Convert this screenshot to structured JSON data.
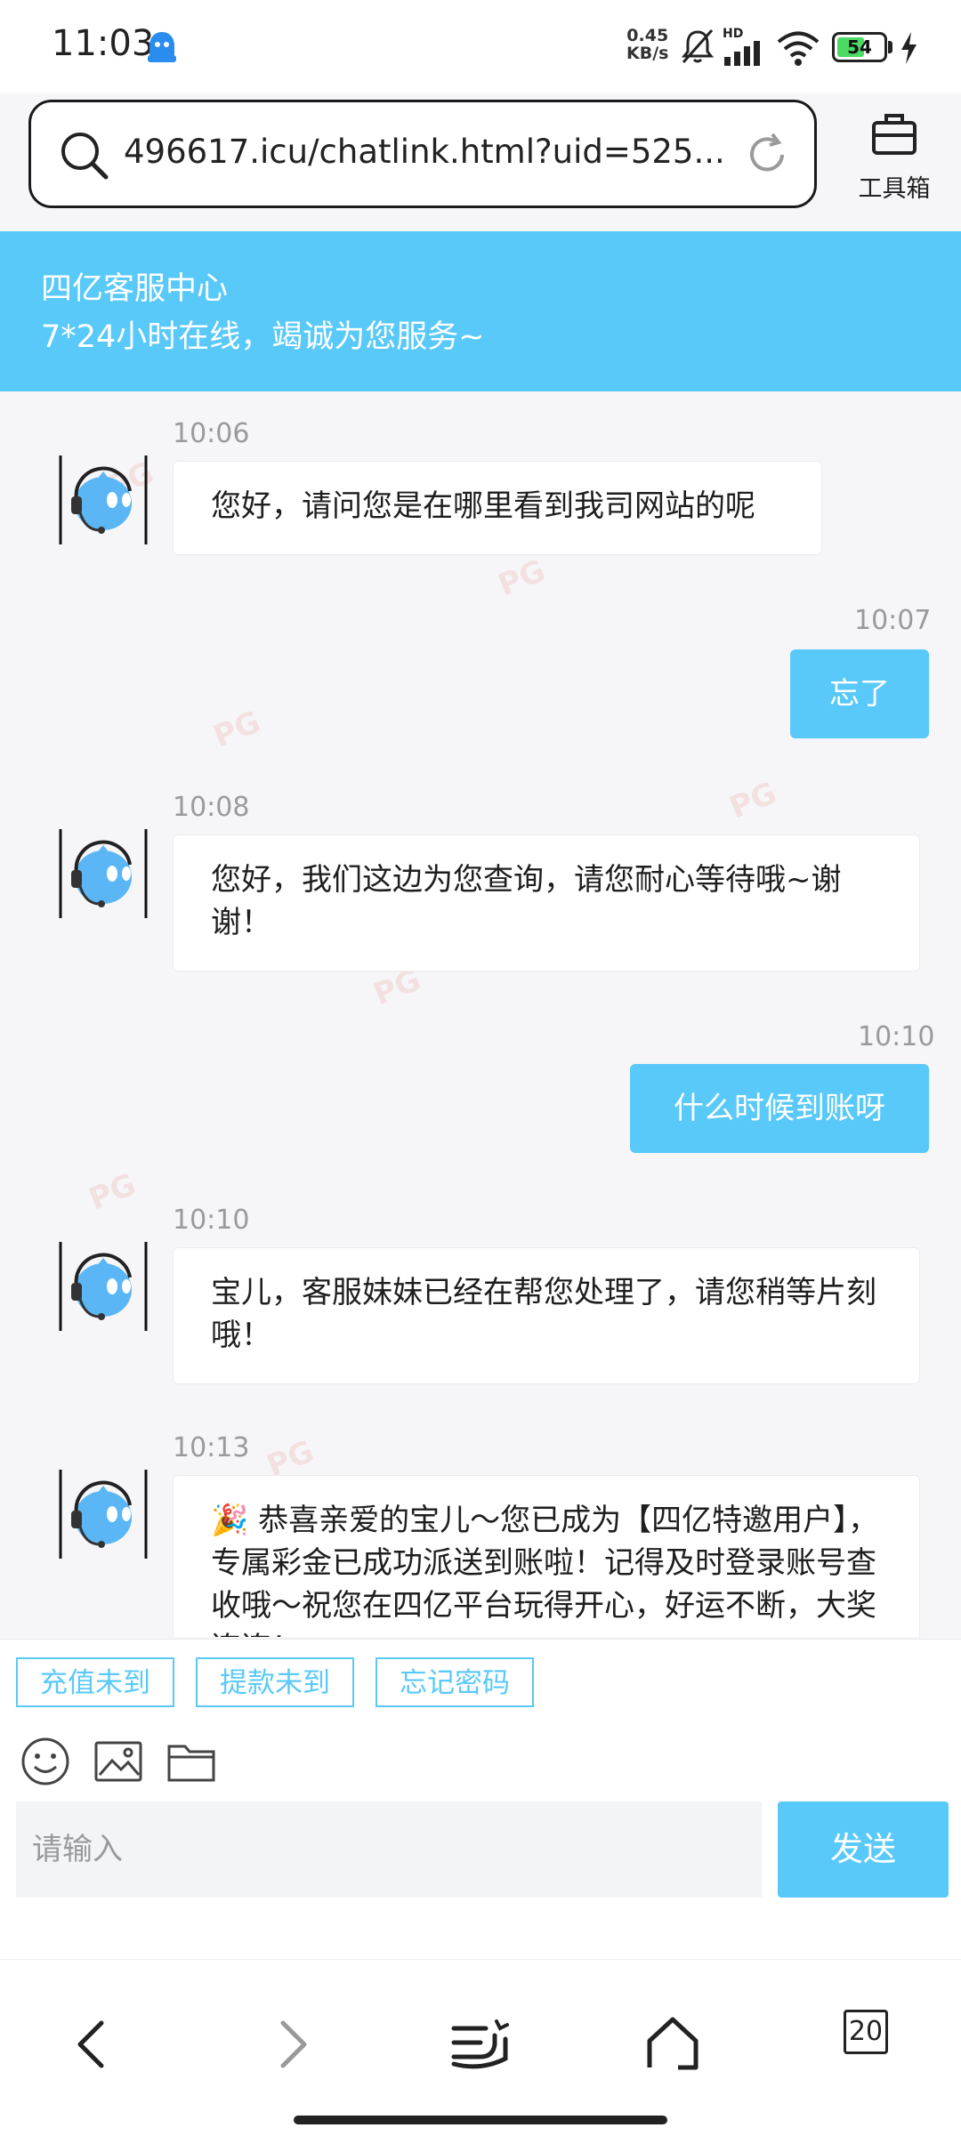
{
  "status_bar": {
    "time": "11:03",
    "network_speed_value": "0.45",
    "network_speed_unit": "KB/s",
    "signal_label": "HD",
    "battery_level": "54",
    "icons": [
      "app-notification-icon",
      "mute-bell-icon",
      "signal-icon",
      "wifi-icon",
      "battery-icon",
      "charging-bolt-icon"
    ]
  },
  "browser": {
    "url": "496617.icu/chatlink.html?uid=525...",
    "toolbox_label": "工具箱"
  },
  "header": {
    "title": "四亿客服中心",
    "subtitle": "7*24小时在线，竭诚为您服务~"
  },
  "messages": [
    {
      "side": "in",
      "time": "10:06",
      "text": "您好，请问您是在哪里看到我司网站的呢"
    },
    {
      "side": "out",
      "time": "10:07",
      "text": "忘了"
    },
    {
      "side": "in",
      "time": "10:08",
      "text": "您好，我们这边为您查询，请您耐心等待哦~谢谢！"
    },
    {
      "side": "out",
      "time": "10:10",
      "text": "什么时候到账呀"
    },
    {
      "side": "in",
      "time": "10:10",
      "text": "宝儿，客服妹妹已经在帮您处理了，请您稍等片刻哦！"
    },
    {
      "side": "in",
      "time": "10:13",
      "text": "🎉 恭喜亲爱的宝儿～您已成为【四亿特邀用户】，专属彩金已成功派送到账啦！记得及时登录账号查收哦～祝您在四亿平台玩得开心，好运不断，大奖连连！"
    }
  ],
  "quick_replies": [
    "充值未到",
    "提款未到",
    "忘记密码"
  ],
  "composer": {
    "placeholder": "请输入",
    "send_label": "发送"
  },
  "nav": {
    "tab_count": "20"
  },
  "colors": {
    "accent": "#59c9fa",
    "bubble_in": "#ffffff",
    "chat_bg": "#f6f6f8"
  }
}
